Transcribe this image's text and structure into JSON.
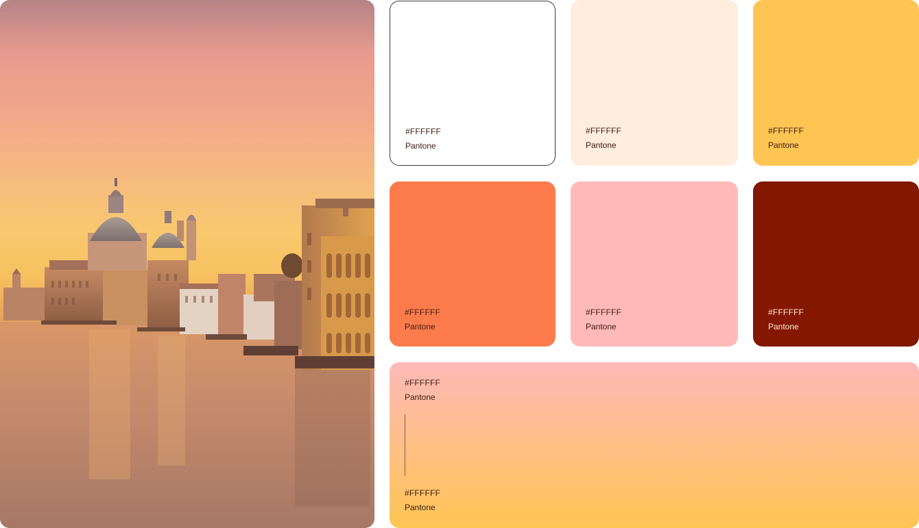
{
  "photo": {
    "subject": "venice-grand-canal-sunset"
  },
  "palette": {
    "swatches": [
      {
        "hex_label": "#FFFFFF",
        "name_label": "Pantone",
        "fill": "#FFFFFF"
      },
      {
        "hex_label": "#FFFFFF",
        "name_label": "Pantone",
        "fill": "#FFEDDD"
      },
      {
        "hex_label": "#FFFFFF",
        "name_label": "Pantone",
        "fill": "#FFC553"
      },
      {
        "hex_label": "#FFFFFF",
        "name_label": "Pantone",
        "fill": "#FE7B4C"
      },
      {
        "hex_label": "#FFFFFF",
        "name_label": "Pantone",
        "fill": "#FFB9B8"
      },
      {
        "hex_label": "#FFFFFF",
        "name_label": "Pantone",
        "fill": "#831700"
      }
    ],
    "gradient": {
      "start": {
        "hex_label": "#FFFFFF",
        "name_label": "Pantone",
        "fill": "#FFB9B8"
      },
      "end": {
        "hex_label": "#FFFFFF",
        "name_label": "Pantone",
        "fill": "#FFC553"
      }
    }
  }
}
